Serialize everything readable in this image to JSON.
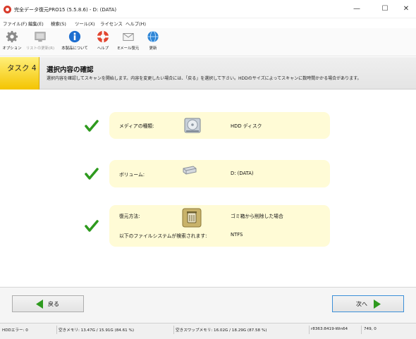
{
  "window": {
    "title": "完全データ復元PRO15 (5.5.8.6) - D: (DATA)",
    "min_glyph": "—",
    "max_glyph": "☐",
    "close_glyph": "✕"
  },
  "menu": [
    {
      "label": "ファイル(F)"
    },
    {
      "label": "編集(E)"
    },
    {
      "label": "検索(S)"
    },
    {
      "label": "ツール(X)"
    },
    {
      "label": "ライセンス"
    },
    {
      "label": "ヘルプ(H)"
    }
  ],
  "toolbar": [
    {
      "label": "オプション",
      "icon": "gear-icon",
      "enabled": true
    },
    {
      "label": "リストの更新(R)",
      "icon": "list-refresh-icon",
      "enabled": false
    },
    {
      "label": "本製品について",
      "icon": "info-icon",
      "enabled": true
    },
    {
      "label": "ヘルプ",
      "icon": "lifebuoy-icon",
      "enabled": true
    },
    {
      "label": "Eメール復元",
      "icon": "envelope-icon",
      "enabled": true
    },
    {
      "label": "更新",
      "icon": "update-globe-icon",
      "enabled": true
    }
  ],
  "task": {
    "badge": "タスク 4",
    "title": "選択内容の確認",
    "description": "選択内容を確認してスキャンを開始します。内容を変更したい場合には、「戻る」を選択して下さい。HDDのサイズによってスキャンに数時間かかる場合があります。"
  },
  "summary": {
    "media": {
      "label": "メディアの種類:",
      "value": "HDD ディスク",
      "icon": "hard-disk-icon"
    },
    "volume": {
      "label": "ボリューム:",
      "value": "D: (DATA)",
      "icon": "volume-drive-icon"
    },
    "restore": {
      "label": "復元方法:",
      "value": "ゴミ箱から削除した場合",
      "fs_label": "以下のファイルシステムが検索されます:",
      "fs_value": "NTFS",
      "icon": "recycle-bin-icon"
    }
  },
  "buttons": {
    "back": "戻る",
    "next": "次へ"
  },
  "status": {
    "hdd_errors": "HDDエラー: 0",
    "free_memory": "空きメモリ: 13.47G / 15.91G (84.61 %)",
    "free_swap": "空きスワップメモリ: 16.02G / 18.29G (87.58 %)",
    "build": "r8363:8419-Win64",
    "coords": "749, 0"
  },
  "colors": {
    "accent_yellow": "#f4c400",
    "row_bg": "#fffbd6",
    "check_green": "#2e9a1e",
    "next_border": "#3b8fd8"
  }
}
